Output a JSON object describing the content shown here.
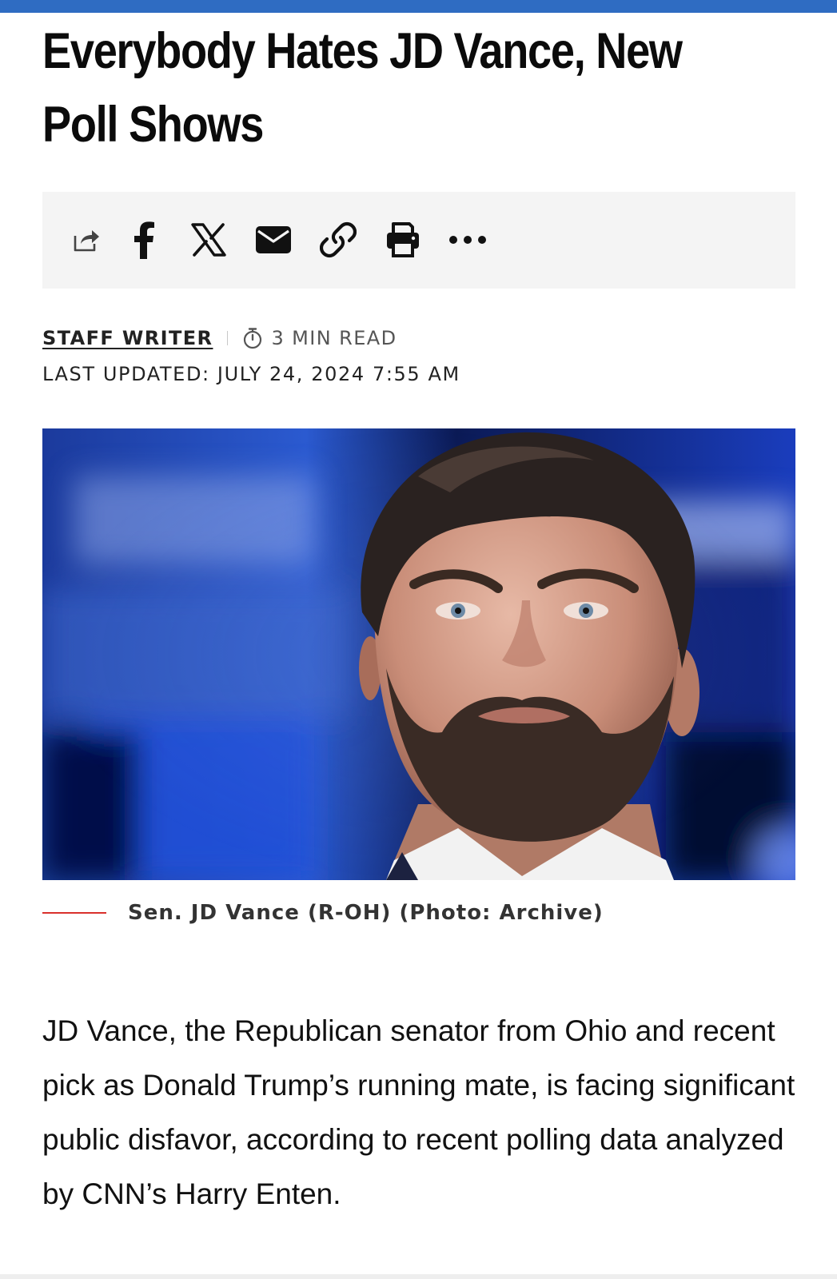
{
  "article": {
    "headline": "Everybody Hates JD Vance, New Poll Shows",
    "author": "STAFF WRITER",
    "read_time": "3 MIN READ",
    "last_updated": "LAST UPDATED: JULY 24, 2024 7:55 AM",
    "image_caption": "Sen. JD Vance (R-OH) (Photo: Archive)",
    "lead_paragraph": "JD Vance, the Republican senator from Ohio and recent pick as Donald Trump’s running mate, is facing significant public disfavor, according to recent polling data analyzed by CNN’s Harry Enten."
  },
  "share_bar": {
    "icons": [
      "share-icon",
      "facebook-icon",
      "x-icon",
      "email-icon",
      "link-icon",
      "print-icon",
      "more-icon"
    ]
  },
  "colors": {
    "accent_top_bar": "#2f6cc2",
    "caption_rule": "#d9302c",
    "share_bar_background": "#f4f4f4"
  }
}
